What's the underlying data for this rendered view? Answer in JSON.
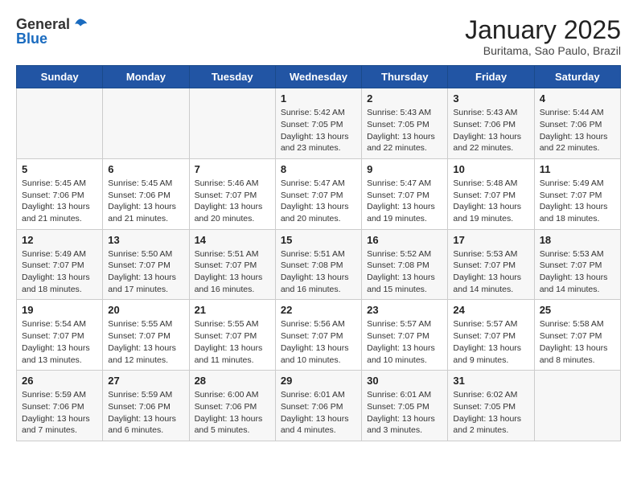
{
  "header": {
    "logo_line1": "General",
    "logo_line2": "Blue",
    "month_title": "January 2025",
    "location": "Buritama, Sao Paulo, Brazil"
  },
  "days_of_week": [
    "Sunday",
    "Monday",
    "Tuesday",
    "Wednesday",
    "Thursday",
    "Friday",
    "Saturday"
  ],
  "weeks": [
    [
      {
        "day": "",
        "info": ""
      },
      {
        "day": "",
        "info": ""
      },
      {
        "day": "",
        "info": ""
      },
      {
        "day": "1",
        "info": "Sunrise: 5:42 AM\nSunset: 7:05 PM\nDaylight: 13 hours\nand 23 minutes."
      },
      {
        "day": "2",
        "info": "Sunrise: 5:43 AM\nSunset: 7:05 PM\nDaylight: 13 hours\nand 22 minutes."
      },
      {
        "day": "3",
        "info": "Sunrise: 5:43 AM\nSunset: 7:06 PM\nDaylight: 13 hours\nand 22 minutes."
      },
      {
        "day": "4",
        "info": "Sunrise: 5:44 AM\nSunset: 7:06 PM\nDaylight: 13 hours\nand 22 minutes."
      }
    ],
    [
      {
        "day": "5",
        "info": "Sunrise: 5:45 AM\nSunset: 7:06 PM\nDaylight: 13 hours\nand 21 minutes."
      },
      {
        "day": "6",
        "info": "Sunrise: 5:45 AM\nSunset: 7:06 PM\nDaylight: 13 hours\nand 21 minutes."
      },
      {
        "day": "7",
        "info": "Sunrise: 5:46 AM\nSunset: 7:07 PM\nDaylight: 13 hours\nand 20 minutes."
      },
      {
        "day": "8",
        "info": "Sunrise: 5:47 AM\nSunset: 7:07 PM\nDaylight: 13 hours\nand 20 minutes."
      },
      {
        "day": "9",
        "info": "Sunrise: 5:47 AM\nSunset: 7:07 PM\nDaylight: 13 hours\nand 19 minutes."
      },
      {
        "day": "10",
        "info": "Sunrise: 5:48 AM\nSunset: 7:07 PM\nDaylight: 13 hours\nand 19 minutes."
      },
      {
        "day": "11",
        "info": "Sunrise: 5:49 AM\nSunset: 7:07 PM\nDaylight: 13 hours\nand 18 minutes."
      }
    ],
    [
      {
        "day": "12",
        "info": "Sunrise: 5:49 AM\nSunset: 7:07 PM\nDaylight: 13 hours\nand 18 minutes."
      },
      {
        "day": "13",
        "info": "Sunrise: 5:50 AM\nSunset: 7:07 PM\nDaylight: 13 hours\nand 17 minutes."
      },
      {
        "day": "14",
        "info": "Sunrise: 5:51 AM\nSunset: 7:07 PM\nDaylight: 13 hours\nand 16 minutes."
      },
      {
        "day": "15",
        "info": "Sunrise: 5:51 AM\nSunset: 7:08 PM\nDaylight: 13 hours\nand 16 minutes."
      },
      {
        "day": "16",
        "info": "Sunrise: 5:52 AM\nSunset: 7:08 PM\nDaylight: 13 hours\nand 15 minutes."
      },
      {
        "day": "17",
        "info": "Sunrise: 5:53 AM\nSunset: 7:07 PM\nDaylight: 13 hours\nand 14 minutes."
      },
      {
        "day": "18",
        "info": "Sunrise: 5:53 AM\nSunset: 7:07 PM\nDaylight: 13 hours\nand 14 minutes."
      }
    ],
    [
      {
        "day": "19",
        "info": "Sunrise: 5:54 AM\nSunset: 7:07 PM\nDaylight: 13 hours\nand 13 minutes."
      },
      {
        "day": "20",
        "info": "Sunrise: 5:55 AM\nSunset: 7:07 PM\nDaylight: 13 hours\nand 12 minutes."
      },
      {
        "day": "21",
        "info": "Sunrise: 5:55 AM\nSunset: 7:07 PM\nDaylight: 13 hours\nand 11 minutes."
      },
      {
        "day": "22",
        "info": "Sunrise: 5:56 AM\nSunset: 7:07 PM\nDaylight: 13 hours\nand 10 minutes."
      },
      {
        "day": "23",
        "info": "Sunrise: 5:57 AM\nSunset: 7:07 PM\nDaylight: 13 hours\nand 10 minutes."
      },
      {
        "day": "24",
        "info": "Sunrise: 5:57 AM\nSunset: 7:07 PM\nDaylight: 13 hours\nand 9 minutes."
      },
      {
        "day": "25",
        "info": "Sunrise: 5:58 AM\nSunset: 7:07 PM\nDaylight: 13 hours\nand 8 minutes."
      }
    ],
    [
      {
        "day": "26",
        "info": "Sunrise: 5:59 AM\nSunset: 7:06 PM\nDaylight: 13 hours\nand 7 minutes."
      },
      {
        "day": "27",
        "info": "Sunrise: 5:59 AM\nSunset: 7:06 PM\nDaylight: 13 hours\nand 6 minutes."
      },
      {
        "day": "28",
        "info": "Sunrise: 6:00 AM\nSunset: 7:06 PM\nDaylight: 13 hours\nand 5 minutes."
      },
      {
        "day": "29",
        "info": "Sunrise: 6:01 AM\nSunset: 7:06 PM\nDaylight: 13 hours\nand 4 minutes."
      },
      {
        "day": "30",
        "info": "Sunrise: 6:01 AM\nSunset: 7:05 PM\nDaylight: 13 hours\nand 3 minutes."
      },
      {
        "day": "31",
        "info": "Sunrise: 6:02 AM\nSunset: 7:05 PM\nDaylight: 13 hours\nand 2 minutes."
      },
      {
        "day": "",
        "info": ""
      }
    ]
  ]
}
